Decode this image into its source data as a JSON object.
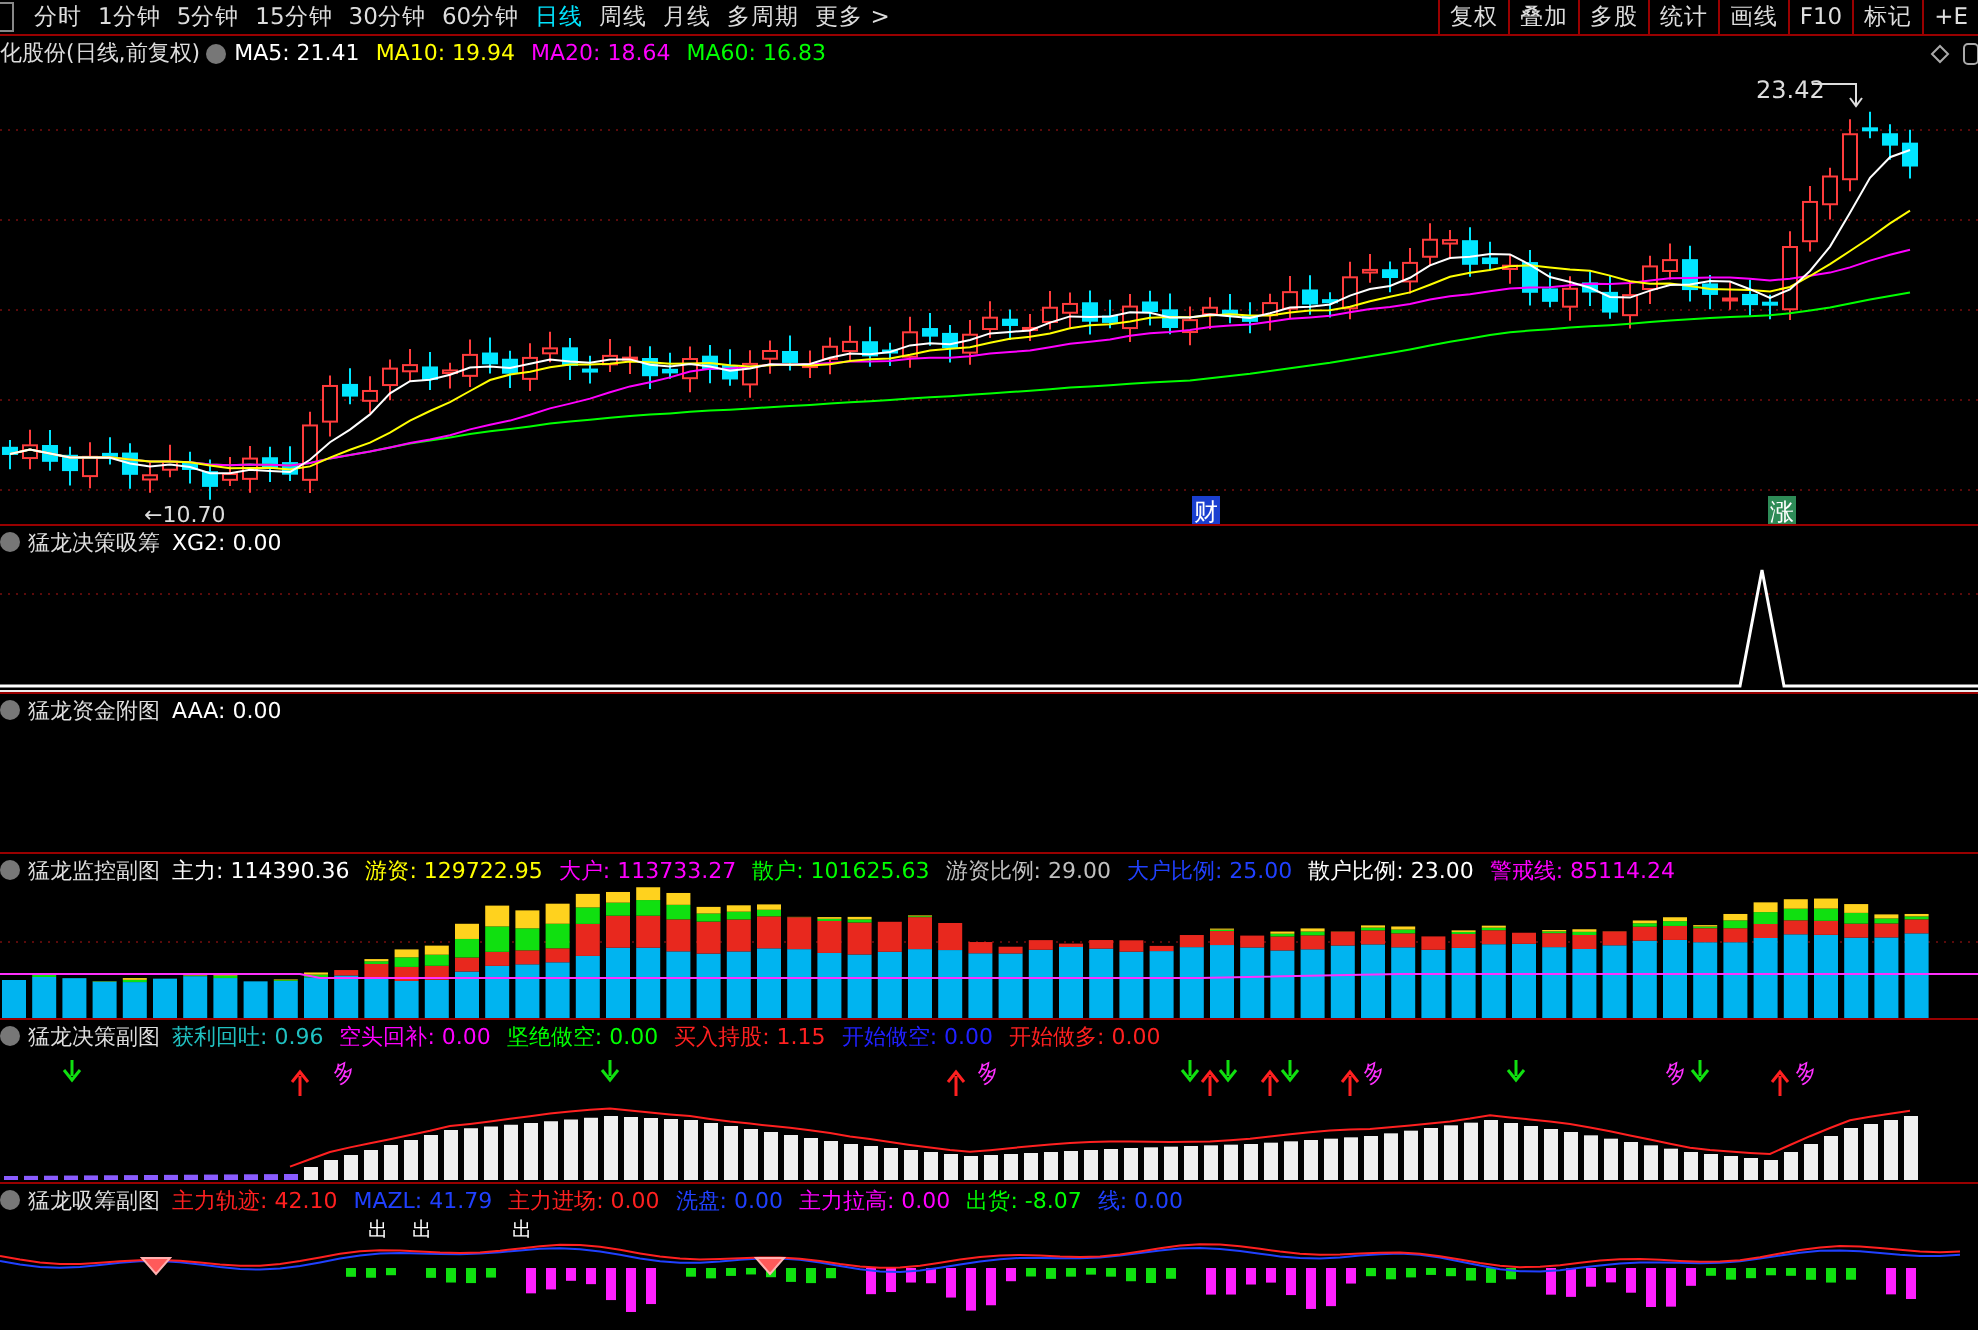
{
  "toolbar": {
    "periods": [
      {
        "label": "分时",
        "selected": false
      },
      {
        "label": "1分钟",
        "selected": false
      },
      {
        "label": "5分钟",
        "selected": false
      },
      {
        "label": "15分钟",
        "selected": false
      },
      {
        "label": "30分钟",
        "selected": false
      },
      {
        "label": "60分钟",
        "selected": false
      },
      {
        "label": "日线",
        "selected": true
      },
      {
        "label": "周线",
        "selected": false
      },
      {
        "label": "月线",
        "selected": false
      },
      {
        "label": "多周期",
        "selected": false
      },
      {
        "label": "更多 >",
        "selected": false
      }
    ],
    "buttons": [
      "复权",
      "叠加",
      "多股",
      "统计",
      "画线",
      "F10",
      "标记",
      "+E"
    ]
  },
  "main_chart": {
    "title": "化股份(日线,前复权)",
    "indicators": [
      {
        "text": "MA5: 21.41",
        "color": "#ffffff"
      },
      {
        "text": "MA10: 19.94",
        "color": "#ffff00"
      },
      {
        "text": "MA20: 18.64",
        "color": "#ff00ff"
      },
      {
        "text": "MA60: 16.83",
        "color": "#00ff00"
      }
    ],
    "high_label": "23.42",
    "low_label": "←10.70",
    "badges": [
      {
        "text": "财",
        "color": "#1a3fd0"
      },
      {
        "text": "涨",
        "color": "#2e8b57"
      }
    ]
  },
  "panels": [
    {
      "kind": "spike",
      "title": "猛龙决策吸筹",
      "indicators": [
        {
          "text": "XG2: 0.00",
          "color": "#ffffff"
        }
      ]
    },
    {
      "kind": "empty",
      "title": "猛龙资金附图",
      "indicators": [
        {
          "text": "AAA: 0.00",
          "color": "#ffffff"
        }
      ]
    },
    {
      "kind": "stacked",
      "title": "猛龙监控副图",
      "indicators": [
        {
          "text": "主力: 114390.36",
          "color": "#ffffff"
        },
        {
          "text": "游资: 129722.95",
          "color": "#ffff00"
        },
        {
          "text": "大户: 113733.27",
          "color": "#ff00ff"
        },
        {
          "text": "散户: 101625.63",
          "color": "#00ff00"
        },
        {
          "text": "游资比例: 29.00",
          "color": "#c0c0c0"
        },
        {
          "text": "大户比例: 25.00",
          "color": "#2040ff"
        },
        {
          "text": "散户比例: 23.00",
          "color": "#ffffff"
        },
        {
          "text": "警戒线: 85114.24",
          "color": "#ff00ff"
        }
      ]
    },
    {
      "kind": "wave",
      "title": "猛龙决策副图",
      "indicators": [
        {
          "text": "获利回吐: 0.96",
          "color": "#20c0c0"
        },
        {
          "text": "空头回补: 0.00",
          "color": "#ff00ff"
        },
        {
          "text": "坚绝做空: 0.00",
          "color": "#00ff00"
        },
        {
          "text": "买入持股: 1.15",
          "color": "#ff2020"
        },
        {
          "text": "开始做空: 0.00",
          "color": "#2020ff"
        },
        {
          "text": "开始做多: 0.00",
          "color": "#ff2020"
        }
      ],
      "marks": [
        "多",
        "多",
        "多",
        "多",
        "多"
      ]
    },
    {
      "kind": "lines",
      "title": "猛龙吸筹副图",
      "indicators": [
        {
          "text": "主力轨迹: 42.10",
          "color": "#ff2020"
        },
        {
          "text": "MAZL: 41.79",
          "color": "#2040ff"
        },
        {
          "text": "主力进场: 0.00",
          "color": "#ff2020"
        },
        {
          "text": "洗盘: 0.00",
          "color": "#2040ff"
        },
        {
          "text": "主力拉高: 0.00",
          "color": "#ff00ff"
        },
        {
          "text": "出货: -8.07",
          "color": "#00ff00"
        },
        {
          "text": "线: 0.00",
          "color": "#2040ff"
        }
      ],
      "marks": [
        "出",
        "出",
        "出"
      ]
    }
  ]
}
